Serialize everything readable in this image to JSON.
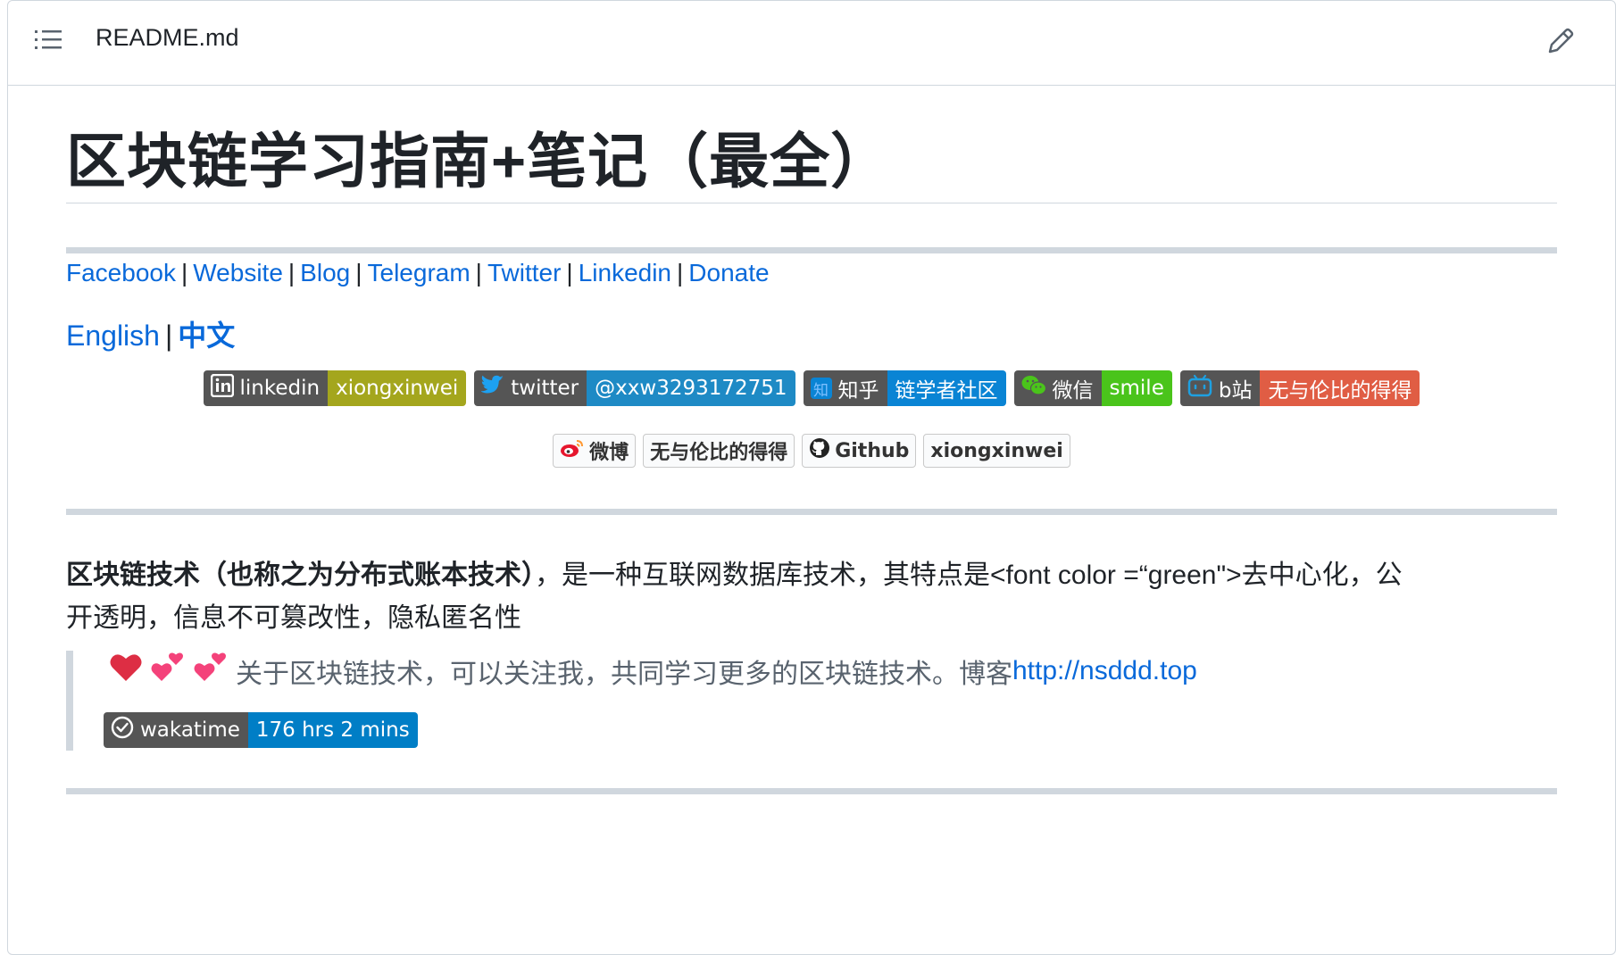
{
  "header": {
    "filename": "README.md",
    "toc_icon": "list-icon",
    "edit_icon": "pencil-icon"
  },
  "title": "区块链学习指南+笔记（最全）",
  "social_links": [
    "Facebook",
    "Website",
    "Blog",
    "Telegram",
    "Twitter",
    "Linkedin",
    "Donate"
  ],
  "language_links": {
    "english": "English",
    "chinese": "中文"
  },
  "badges_row1": [
    {
      "icon": "linkedin-icon",
      "label": "linkedin",
      "value": "xiongxinwei",
      "color": "#a4a61d"
    },
    {
      "icon": "twitter-icon",
      "label": "twitter",
      "value": "@xxw3293172751",
      "color": "#1e8ac5"
    },
    {
      "icon": "zhihu-icon",
      "label": "知乎",
      "value": "链学者社区",
      "color": "#0a84d4"
    },
    {
      "icon": "wechat-icon",
      "label": "微信",
      "value": "smile",
      "color": "#4ac41b"
    },
    {
      "icon": "bilibili-icon",
      "label": "b站",
      "value": "无与伦比的得得",
      "color": "#e05d44"
    }
  ],
  "badges_row2": [
    {
      "icon": "weibo-icon",
      "label": "微博"
    },
    {
      "label": "无与伦比的得得"
    },
    {
      "icon": "github-icon",
      "label": "Github"
    },
    {
      "label": "xiongxinwei"
    }
  ],
  "intro": {
    "bold": "区块链技术（也称之为分布式账本技术）",
    "line1": "，是一种互联网数据库技术，其特点是<font color =“green\">去中心化，公",
    "line2": "开透明，信息不可篡改性，隐私匿名性"
  },
  "quote": {
    "text": "关于区块链技术，可以关注我，共同学习更多的区块链技术。博客",
    "link": "http://nsddd.top"
  },
  "wakatime": {
    "icon": "wakatime-icon",
    "label": "wakatime",
    "value": "176 hrs 2 mins",
    "color": "#007ec6"
  }
}
